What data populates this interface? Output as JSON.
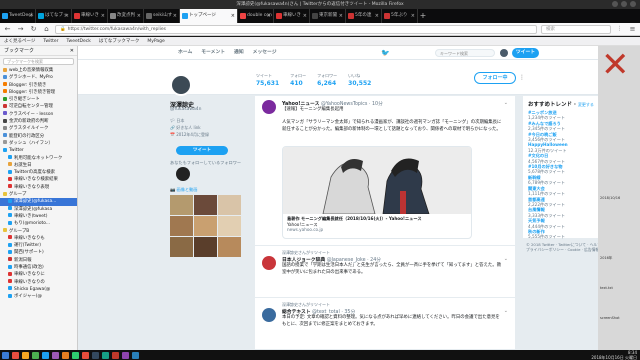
{
  "window": {
    "title": "深澤諒史(@fukasawa4n)さん | Twitterからの返信付きツイート - Mozilla Firefox"
  },
  "tabs": [
    {
      "label": "TweetDeck",
      "color": "#1da1f2"
    },
    {
      "label": "はてなブッ",
      "color": "#00a4de"
    },
    {
      "label": "車線いき",
      "color": "#d33"
    },
    {
      "label": "改変点判",
      "color": "#888"
    },
    {
      "label": "seiki山す",
      "color": "#666"
    },
    {
      "label": "トップページ",
      "color": "#1da1f2",
      "active": true
    },
    {
      "label": "double con",
      "color": "#e44"
    },
    {
      "label": "車線いき",
      "color": "#d33"
    },
    {
      "label": "東京新聞",
      "color": "#444"
    },
    {
      "label": "5年の連",
      "color": "#c33"
    },
    {
      "label": "5年ぶり",
      "color": "#c33"
    }
  ],
  "nav": {
    "url": "https://twitter.com/fukasawa4n/with_replies",
    "search_placeholder": "検索"
  },
  "bookmarks_bar": [
    "よく見るページ",
    "Twitter",
    "TweetDeck",
    "はてなブックマーク",
    "MyPage"
  ],
  "sidebar": {
    "title": "ブックマーク",
    "search_placeholder": "ブックマークを検索",
    "items": [
      {
        "label": "web上の音楽情報収集",
        "color": "#e8a33c"
      },
      {
        "label": "グラシホード、MyPro",
        "color": "#4a90d9"
      },
      {
        "label": "Blogger: 引き続き",
        "color": "#f57d00"
      },
      {
        "label": "Blogger: 引き続き管理",
        "color": "#f57d00"
      },
      {
        "label": "引き継ぎシート",
        "color": "#2a9d2a"
      },
      {
        "label": "可逆自転センター管理",
        "color": "#c33"
      },
      {
        "label": "クラスペイー - lesson",
        "color": "#6a5acd"
      },
      {
        "label": "金沢の新政府の判断",
        "color": "#444"
      },
      {
        "label": "グラスタイルイーク",
        "color": "#888"
      },
      {
        "label": "能登町の行政区分",
        "color": "#4a90d9"
      },
      {
        "label": "ダッシュ（ハイフン）",
        "color": "#999"
      },
      {
        "label": "Twitter",
        "color": "#1da1f2"
      },
      {
        "label": "利用可能なネットワーク",
        "color": "#1da1f2"
      },
      {
        "label": "お誕生日",
        "color": "#e8a33c"
      },
      {
        "label": "Twitterの高度な検索",
        "color": "#1da1f2"
      },
      {
        "label": "車線いきなり検索結果",
        "color": "#d33"
      },
      {
        "label": "車線いきなり表現",
        "color": "#d33"
      },
      {
        "label": "グループ",
        "color": "#e8c33c"
      },
      {
        "label": "深澤諒史(@fukasa...",
        "color": "#1da1f2",
        "selected": true
      },
      {
        "label": "深澤諒史(@fukasa",
        "color": "#1da1f2"
      },
      {
        "label": "車線いき(tweet)",
        "color": "#1da1f2"
      },
      {
        "label": "もり(@morioto...",
        "color": "#1da1f2"
      },
      {
        "label": "グループB",
        "color": "#e8c33c"
      },
      {
        "label": "車線いきなりも",
        "color": "#d33"
      },
      {
        "label": "運行(Twitter)",
        "color": "#1da1f2"
      },
      {
        "label": "関西(サポート)",
        "color": "#1da1f2"
      },
      {
        "label": "新潟日報",
        "color": "#c33"
      },
      {
        "label": "時事通信(政治)",
        "color": "#1da1f2"
      },
      {
        "label": "車線いきなりに",
        "color": "#d33"
      },
      {
        "label": "車線いきなりの",
        "color": "#d33"
      },
      {
        "label": "Shicko Egawa(@",
        "color": "#1da1f2"
      },
      {
        "label": "ボイジャー(@",
        "color": "#1da1f2"
      }
    ]
  },
  "twitter_nav": {
    "items": [
      "ホーム",
      "モーメント",
      "通知",
      "メッセージ"
    ],
    "search_placeholder": "キーワード検索",
    "tweet_button": "ツイート"
  },
  "stats": [
    {
      "label": "ツイート",
      "value": "75,631"
    },
    {
      "label": "フォロー",
      "value": "410"
    },
    {
      "label": "フォロワー",
      "value": "6,264"
    },
    {
      "label": "いいね",
      "value": "30,552"
    }
  ],
  "follow_button": "フォロー中",
  "profile": {
    "name": "深澤諒史",
    "handle": "@fukasawa4n",
    "meta": [
      "🏳 日本",
      "🔗 好きな人 link",
      "📅 2012年4月に登録"
    ],
    "tweet_button": "ツイート",
    "followers_heading": "あなたもフォローしているフォロワー",
    "photos_heading": "📷 画像と動画",
    "photo_colors": [
      "#b49a6e",
      "#6b4a3a",
      "#d9c4a8",
      "#a07850",
      "#c9a070",
      "#e2cfb2",
      "#8a6a45",
      "#5a3e2b",
      "#b78a5c"
    ]
  },
  "tweets": [
    {
      "avatar_color": "#7b2a9e",
      "retweet_note": "",
      "name": "Yahoo!ニュース",
      "handle": "@YahooNewsTopics · 10分",
      "text": "【速報】モーニング編集長起用\n\n人気マンガ「サラリーマン金太郎」で知られる漫画家が、講談社の週刊マンガ誌「モーニング」の次期編集長に就任することが分かった。編集部の新体制の一環として話題となっており、関係者への取材で明らかになった。",
      "card": {
        "title": "島耕作 モーニング編集長就任（2018/10/16(火)）- Yahoo!ニュース",
        "desc": "Yahoo!ニュース",
        "url": "news.yahoo.co.jp"
      }
    },
    {
      "avatar_color": "#c9353a",
      "retweet_note": "深澤諒史さんがリツイート",
      "name": "日本人ジョーク辞典",
      "handle": "@Japanese_Joke · 24分",
      "text": "国語の授業で「学期は生活日本人だ」と先生が言ったら、全員が一斉に手を挙げて「知ってます」と答えた。教室中が笑いに包まれた日の出来事である。"
    },
    {
      "avatar_color": "#3a6b9e",
      "retweet_note": "深澤諒史さんがリツイート",
      "name": "総合テキスト",
      "handle": "@text_total · 35分",
      "text": "本日の予定: 文章の確認と資料の整理。気になる点があれば早めに連絡してください。昨日の会議で出た意見をもとに、次回までに修正案をまとめておきます。"
    }
  ],
  "trends": {
    "title": "おすすめトレンド",
    "change": "変更する",
    "items": [
      {
        "name": "#ニッポン放送",
        "count": "1,234件のツイート"
      },
      {
        "name": "#みんなで語ろう",
        "count": "2,345件のツイート"
      },
      {
        "name": "#今日の晩ご飯",
        "count": "3,456件のツイート"
      },
      {
        "name": "HappyHalloween",
        "count": "12.3万件のツイート"
      },
      {
        "name": "#文化の日",
        "count": "4,567件のツイート"
      },
      {
        "name": "#10月の好きな物",
        "count": "5,678件のツイート"
      },
      {
        "name": "新幹線",
        "count": "6,789件のツイート"
      },
      {
        "name": "関東大会",
        "count": "1,111件のツイート"
      },
      {
        "name": "首都高速",
        "count": "2,222件のツイート"
      },
      {
        "name": "台風情報",
        "count": "3,333件のツイート"
      },
      {
        "name": "天気予報",
        "count": "4,444件のツイート"
      },
      {
        "name": "秋の新作",
        "count": "5,555件のツイート"
      }
    ],
    "footer": "© 2018 Twitter · Twitterについて · ヘルプセンター · 規約 · プライバシーポリシー · Cookie · 広告情報"
  },
  "desktop": {
    "big_mark": "✕",
    "labels": [
      "2018/10/16",
      "2016年",
      "text.txt",
      "screenShot"
    ]
  },
  "taskbar": {
    "icons": [
      "#3a7bd5",
      "#e84e40",
      "#f5a623",
      "#4caf50",
      "#1da1f2",
      "#9b59b6",
      "#e67e22",
      "#2ecc71",
      "#e74c3c",
      "#34495e",
      "#16a085",
      "#c0392b",
      "#8e44ad",
      "#2980b9"
    ],
    "time": "8:34",
    "date": "2018年10月16日 火曜日"
  }
}
